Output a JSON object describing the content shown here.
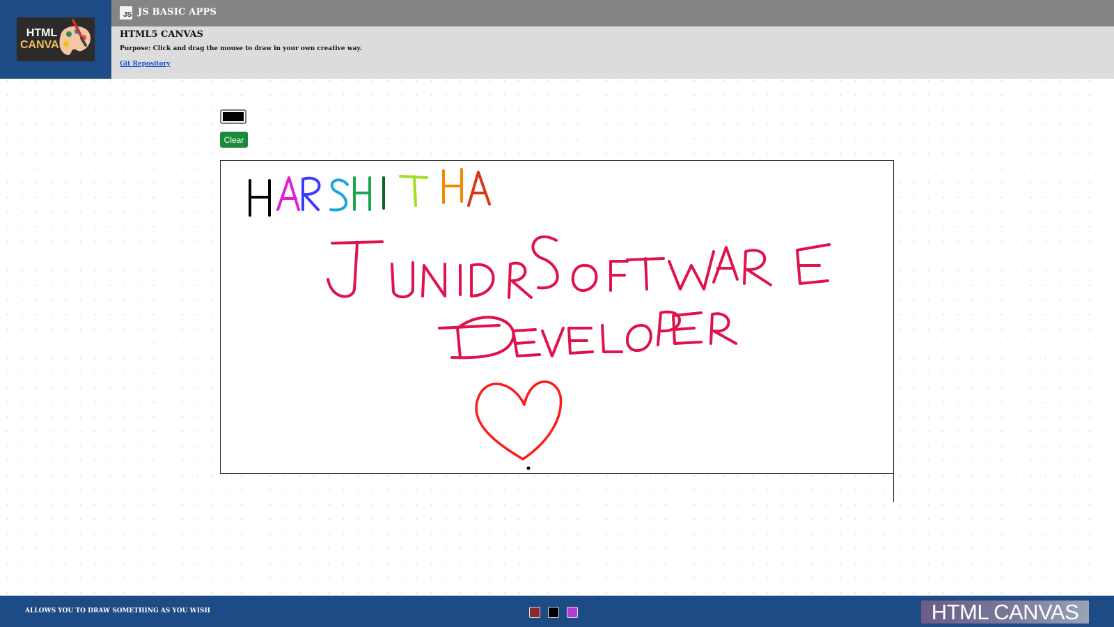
{
  "header": {
    "logo": {
      "line1": "HTML",
      "line2": "CANVAS",
      "icon": "palette-icon"
    },
    "topbar": {
      "icon": "js-icon",
      "icon_text": "JS",
      "title": "JS BASIC APPS"
    },
    "info": {
      "title": "HTML5 CANVAS",
      "purpose": "Purpose: Click and drag the mouse to draw in your own creative way.",
      "link": "Git Repository"
    }
  },
  "toolbar": {
    "color_value": "#000000",
    "clear_label": "Clear"
  },
  "canvas": {
    "drawing_text": [
      "HARSHITHA",
      "JUNIOR SOFTWARE",
      "DEVELOPER"
    ],
    "heart_color": "#ff1a1a",
    "text_color": "#e0114b"
  },
  "footer": {
    "text": "ALLOWS YOU TO DRAW SOMETHING AS YOU WISH",
    "palette": [
      "#8b2a2a",
      "#000000",
      "#b23fd4"
    ],
    "logo_text": "HTML CANVAS"
  }
}
